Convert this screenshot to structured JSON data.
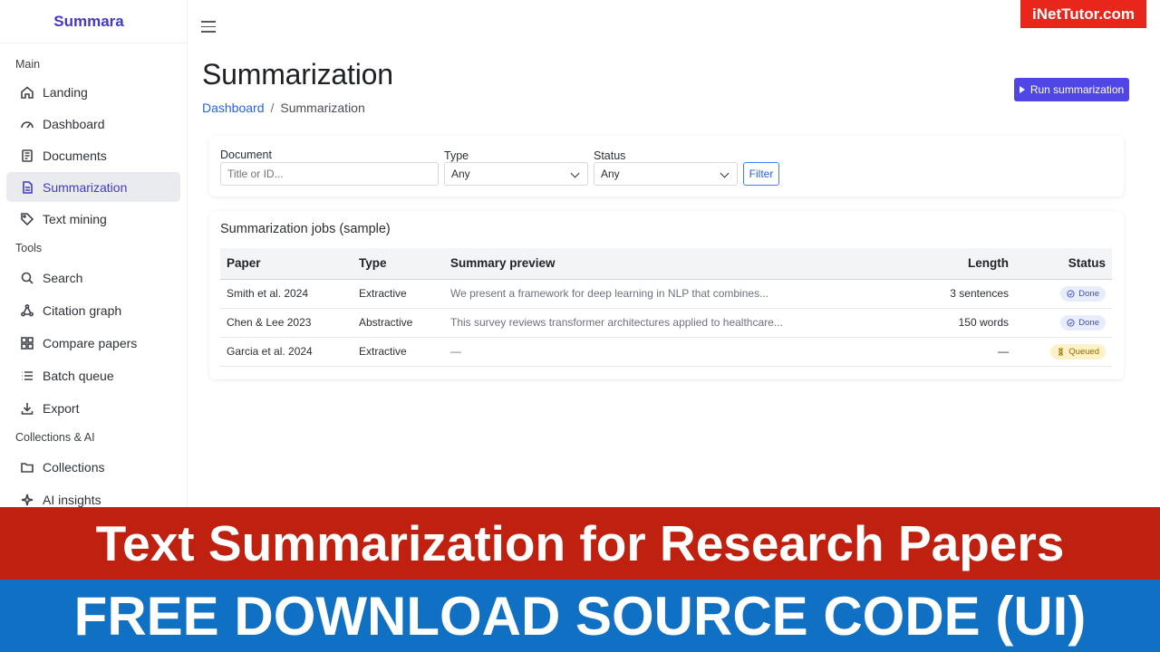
{
  "brand": "Summara",
  "watermark": "iNetTutor.com",
  "sidebar": {
    "sections": [
      {
        "label": "Main",
        "items": [
          {
            "label": "Landing",
            "icon": "home-icon"
          },
          {
            "label": "Dashboard",
            "icon": "gauge-icon"
          },
          {
            "label": "Documents",
            "icon": "document-icon"
          },
          {
            "label": "Summarization",
            "icon": "file-text-icon",
            "active": true
          },
          {
            "label": "Text mining",
            "icon": "tag-icon"
          }
        ]
      },
      {
        "label": "Tools",
        "items": [
          {
            "label": "Search",
            "icon": "search-icon"
          },
          {
            "label": "Citation graph",
            "icon": "graph-icon"
          },
          {
            "label": "Compare papers",
            "icon": "grid-icon"
          },
          {
            "label": "Batch queue",
            "icon": "list-icon"
          },
          {
            "label": "Export",
            "icon": "download-icon"
          }
        ]
      },
      {
        "label": "Collections & AI",
        "items": [
          {
            "label": "Collections",
            "icon": "folder-icon"
          },
          {
            "label": "AI insights",
            "icon": "sparkle-icon"
          }
        ]
      }
    ]
  },
  "header": {
    "title": "Summarization",
    "breadcrumb": {
      "link": "Dashboard",
      "separator": "/",
      "current": "Summarization"
    },
    "run_button": "Run summarization"
  },
  "filters": {
    "document_label": "Document",
    "document_placeholder": "Title or ID...",
    "type_label": "Type",
    "type_value": "Any",
    "status_label": "Status",
    "status_value": "Any",
    "filter_button": "Filter"
  },
  "jobs": {
    "title": "Summarization jobs (sample)",
    "columns": [
      "Paper",
      "Type",
      "Summary preview",
      "Length",
      "Status"
    ],
    "rows": [
      {
        "paper": "Smith et al. 2024",
        "type": "Extractive",
        "preview": "We present a framework for deep learning in NLP that combines...",
        "length": "3 sentences",
        "status": "Done"
      },
      {
        "paper": "Chen & Lee 2023",
        "type": "Abstractive",
        "preview": "This survey reviews transformer architectures applied to healthcare...",
        "length": "150 words",
        "status": "Done"
      },
      {
        "paper": "Garcia et al. 2024",
        "type": "Extractive",
        "preview": "—",
        "length": "—",
        "status": "Queued"
      }
    ]
  },
  "banner": {
    "line1": "Text Summarization for Research Papers",
    "line2": "FREE DOWNLOAD SOURCE CODE (UI)"
  },
  "colors": {
    "accent": "#4f46e5",
    "link": "#2563eb",
    "banner_red": "#c0200f",
    "banner_blue": "#1070c4",
    "watermark_red": "#e8261b"
  }
}
